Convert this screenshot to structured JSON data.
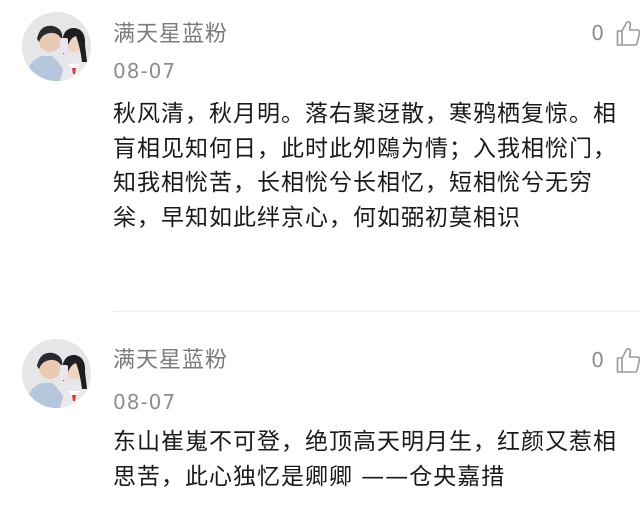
{
  "comments": [
    {
      "username": "满天星蓝粉",
      "date": "08-07",
      "likes": "0",
      "text": "秋风清，秋月明。落右聚迓散，寒鸦栖复惊。相肓相见知何日，此时此夘鴎为情；入我相恱门，知我相恱苦，长相恱兮长相忆，短相恱兮无穷枀，早知如此绊京心，何如弼初莫相识"
    },
    {
      "username": "满天星蓝粉",
      "date": "08-07",
      "likes": "0",
      "text": "东山崔嵬不可登，绝顶高天明月生，红颜又惹相思苦，此心独忆是卿卿 ——仓央嘉措"
    }
  ],
  "colors": {
    "username": "#7b7b7b",
    "meta": "#8e8e8e",
    "text": "#1a1a1a",
    "divider": "#ececec"
  },
  "icons": {
    "like": "thumbs-up-icon"
  }
}
